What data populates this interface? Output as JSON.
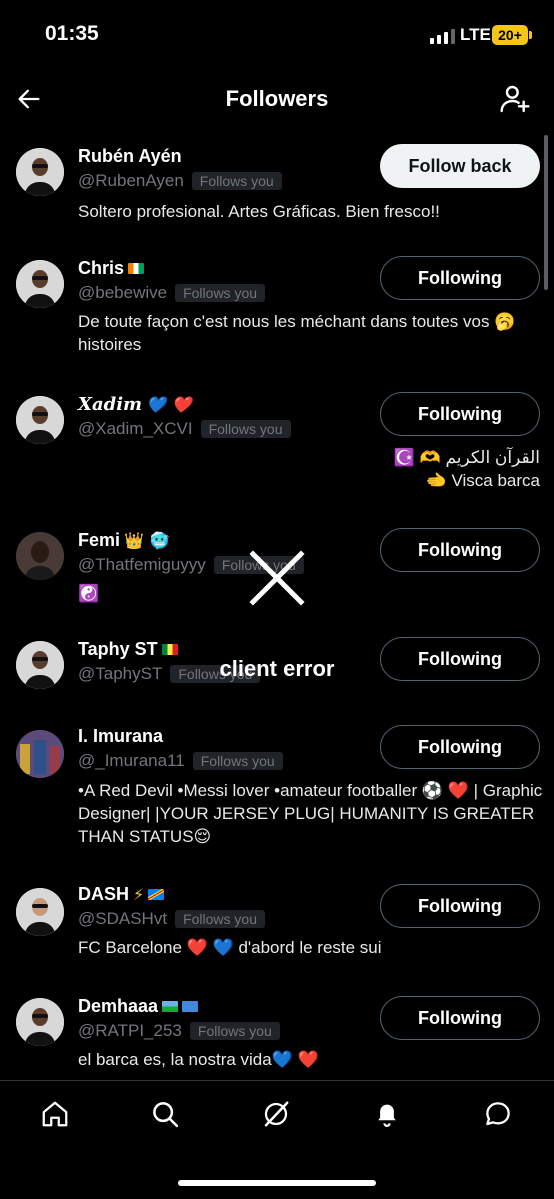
{
  "status_bar": {
    "time": "01:35",
    "network": "LTE",
    "battery": "20+"
  },
  "header": {
    "title": "Followers"
  },
  "followers": [
    {
      "name": "Rubén Ayén",
      "handle": "@RubenAyen",
      "follows_you": "Follows you",
      "bio": "Soltero profesional. Artes Gráficas. Bien fresco!!",
      "button": "Follow back"
    },
    {
      "name": "Chris",
      "handle": "@bebewive",
      "follows_you": "Follows you",
      "bio": "De toute façon c'est nous les méchant dans toutes vos 🥱 histoires",
      "button": "Following"
    },
    {
      "name": "𝑿𝒂𝒅𝒊𝒎",
      "name_emoji": "💙 ❤️",
      "handle": "@Xadim_XCVI",
      "follows_you": "Follows you",
      "bio_line1": "☪️ 🫶 القرآن الكريم",
      "bio_line2": "🫲 Visca barca",
      "button": "Following"
    },
    {
      "name": "Femi",
      "name_emoji": "👑 🥶",
      "handle": "@Thatfemiguyyy",
      "follows_you": "Follows you",
      "bio": "☯️",
      "button": "Following"
    },
    {
      "name": "Taphy ST",
      "handle": "@TaphyST",
      "follows_you": "Follows you",
      "bio": "",
      "button": "Following"
    },
    {
      "name": "I. Imurana",
      "handle": "@_Imurana11",
      "follows_you": "Follows you",
      "bio": "•A Red Devil •Messi lover •amateur footballer ⚽ ❤️ | Graphic Designer| |YOUR JERSEY PLUG| HUMANITY IS GREATER THAN STATUS😌",
      "button": "Following"
    },
    {
      "name": "DASH",
      "name_emoji": "⚡",
      "handle": "@SDASHvt",
      "follows_you": "Follows you",
      "bio": "FC Barcelone ❤️ 💙  d'abord le reste sui",
      "button": "Following"
    },
    {
      "name": "Demhaaa",
      "handle": "@RATPI_253",
      "follows_you": "Follows you",
      "bio": "el barca es, la nostra vida💙 ❤️",
      "button": "Following"
    }
  ],
  "error": {
    "text": "client error"
  },
  "nav": {
    "home_icon": "home-icon",
    "search_icon": "search-icon",
    "grok_icon": "grok-icon",
    "notifications_icon": "bell-icon",
    "messages_icon": "messages-icon"
  },
  "colors": {
    "background": "#000000",
    "text": "#e7e9ea",
    "muted": "#71767b",
    "border": "#536471"
  }
}
